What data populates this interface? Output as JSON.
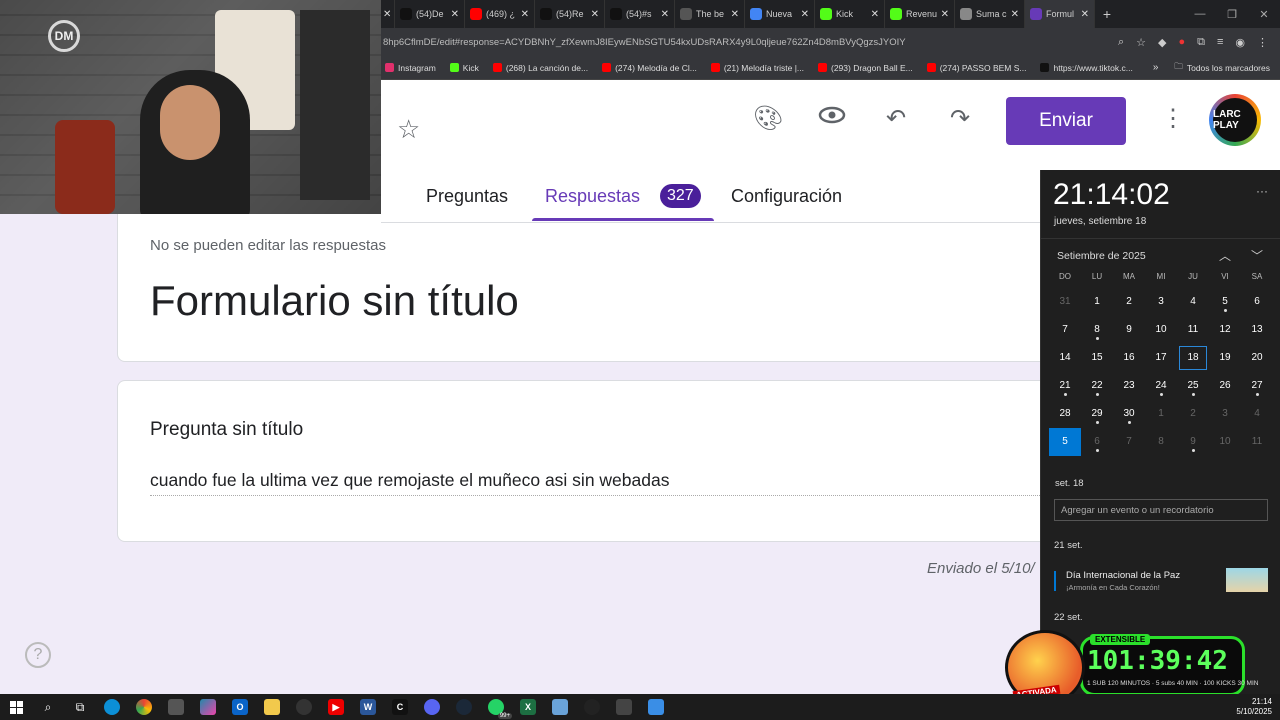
{
  "browser": {
    "tabs": [
      {
        "label": "(54)De",
        "color": "#111"
      },
      {
        "label": "(469) ¿",
        "color": "#ff0000"
      },
      {
        "label": "(54)Re",
        "color": "#111"
      },
      {
        "label": "(54)#s",
        "color": "#111"
      },
      {
        "label": "The be",
        "color": "#555"
      },
      {
        "label": "Nueva",
        "color": "#4285f4"
      },
      {
        "label": "Kick",
        "color": "#53fc18"
      },
      {
        "label": "Revenu",
        "color": "#53fc18"
      },
      {
        "label": "Suma c",
        "color": "#888"
      },
      {
        "label": "Formul",
        "color": "#673ab7"
      }
    ],
    "url": "8hp6CflmDE/edit#response=ACYDBNhY_zfXewmJ8IEywENbSGTU54kxUDsRARX4y9L0qljeue762Zn4D8mBVyQgzsJYOIY",
    "bookmarks": [
      {
        "label": "Instagram",
        "color": "#e1306c"
      },
      {
        "label": "Kick",
        "color": "#53fc18"
      },
      {
        "label": "(268) La canción de...",
        "color": "#ff0000"
      },
      {
        "label": "(274) Melodía de Cl...",
        "color": "#ff0000"
      },
      {
        "label": "(21) Melodía triste |...",
        "color": "#ff0000"
      },
      {
        "label": "(293) Dragon Ball E...",
        "color": "#ff0000"
      },
      {
        "label": "(274) PASSO BEM S...",
        "color": "#ff0000"
      },
      {
        "label": "https://www.tiktok.c...",
        "color": "#111"
      }
    ],
    "bookmarks_more": "»",
    "all_bookmarks": "Todos los marcadores"
  },
  "form": {
    "send_label": "Enviar",
    "avatar_text": "LARC PLAY",
    "tabs": {
      "questions": "Preguntas",
      "responses": "Respuestas",
      "settings": "Configuración"
    },
    "response_count": "327",
    "no_edit": "No se pueden editar las respuestas",
    "title": "Formulario sin título",
    "question": "Pregunta sin título",
    "answer": "cuando fue la ultima vez que remojaste el muñeco asi sin webadas",
    "submitted": "Enviado el 5/10/"
  },
  "webcam": {
    "logo": "DM"
  },
  "calendar": {
    "time": "21:14:02",
    "date_long": "jueves, setiembre 18",
    "month_label": "Setiembre de 2025",
    "weekdays": [
      "DO",
      "LU",
      "MA",
      "MI",
      "JU",
      "VI",
      "SA"
    ],
    "weeks": [
      [
        "31",
        "1",
        "2",
        "3",
        "4",
        "5",
        "6"
      ],
      [
        "7",
        "8",
        "9",
        "10",
        "11",
        "12",
        "13"
      ],
      [
        "14",
        "15",
        "16",
        "17",
        "18",
        "19",
        "20"
      ],
      [
        "21",
        "22",
        "23",
        "24",
        "25",
        "26",
        "27"
      ],
      [
        "28",
        "29",
        "30",
        "1",
        "2",
        "3",
        "4"
      ],
      [
        "5",
        "6",
        "7",
        "8",
        "9",
        "10",
        "11"
      ]
    ],
    "selected_label": "set. 18",
    "add_event_placeholder": "Agregar un evento o un recordatorio",
    "day21_label": "21 set.",
    "event_title": "Día Internacional de la Paz",
    "event_subtitle": "¡Armonía en Cada Corazón!",
    "day22_label": "22 set."
  },
  "timer": {
    "extensible": "EXTENSIBLE",
    "time": "101:39:42",
    "sub": "1 SUB 120 MINUTOS · 5 subs 40 MIN · 100 KICKS 30 MIN",
    "activated": "ACTIVADA"
  },
  "taskbar": {
    "badge": "99+",
    "time": "21:14",
    "date": "5/10/2025"
  }
}
